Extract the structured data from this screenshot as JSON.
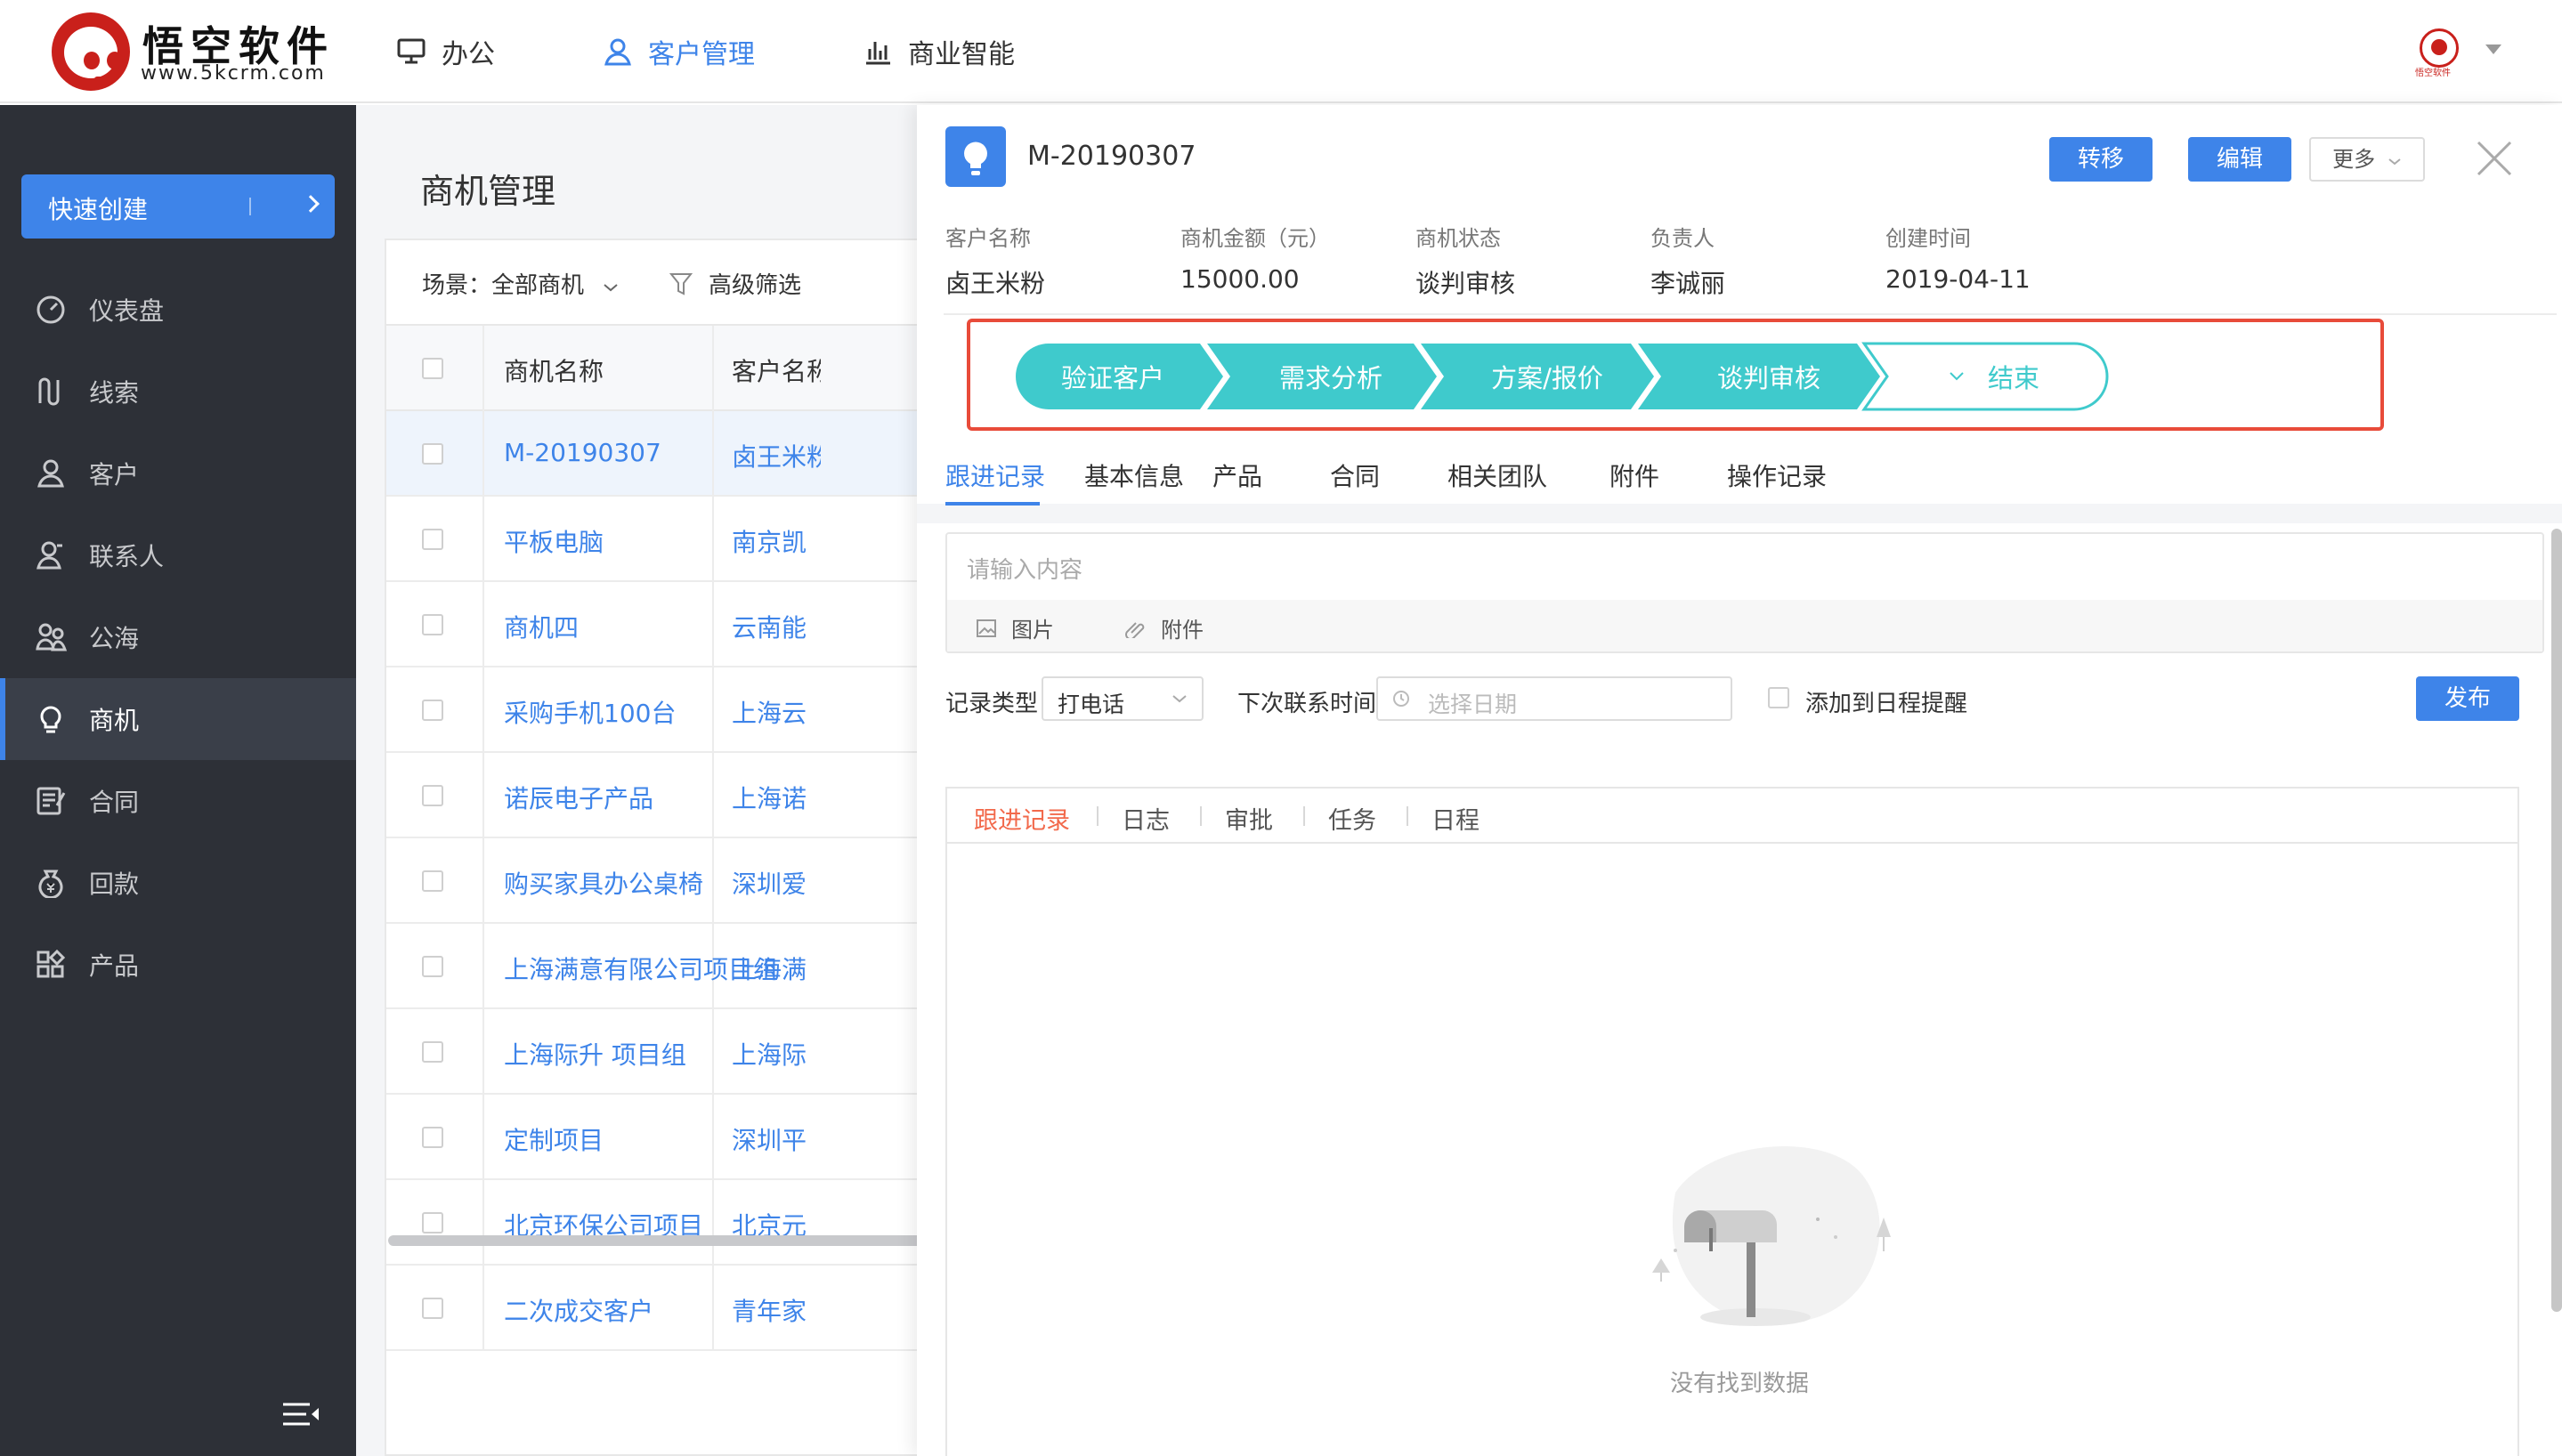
{
  "brand": {
    "name": "悟空软件",
    "url": "www.5kcrm.com",
    "avatar_caption": "悟空软件"
  },
  "topnav": [
    {
      "label": "办公",
      "icon": "monitor-icon",
      "active": false
    },
    {
      "label": "客户管理",
      "icon": "user-icon",
      "active": true
    },
    {
      "label": "商业智能",
      "icon": "bar-chart-icon",
      "active": false
    }
  ],
  "sidebar": {
    "quick_create": "快速创建",
    "items": [
      {
        "label": "仪表盘",
        "icon": "dashboard-icon"
      },
      {
        "label": "线索",
        "icon": "clue-icon"
      },
      {
        "label": "客户",
        "icon": "customer-icon"
      },
      {
        "label": "联系人",
        "icon": "contact-icon"
      },
      {
        "label": "公海",
        "icon": "pool-icon"
      },
      {
        "label": "商机",
        "icon": "bulb-icon",
        "active": true
      },
      {
        "label": "合同",
        "icon": "contract-icon"
      },
      {
        "label": "回款",
        "icon": "payment-icon"
      },
      {
        "label": "产品",
        "icon": "product-icon"
      }
    ]
  },
  "page": {
    "title": "商机管理",
    "scene_label": "场景：全部商机",
    "advanced_filter": "高级筛选",
    "columns": [
      "商机名称",
      "客户名称"
    ],
    "rows": [
      {
        "name": "M-20190307",
        "customer": "卤王米粉"
      },
      {
        "name": "平板电脑",
        "customer": "南京凯"
      },
      {
        "name": "商机四",
        "customer": "云南能"
      },
      {
        "name": "采购手机100台",
        "customer": "上海云"
      },
      {
        "name": "诺辰电子产品",
        "customer": "上海诺"
      },
      {
        "name": "购买家具办公桌椅",
        "customer": "深圳爱"
      },
      {
        "name": "上海满意有限公司项目组",
        "customer": "上海满"
      },
      {
        "name": "上海际升 项目组",
        "customer": "上海际"
      },
      {
        "name": "定制项目",
        "customer": "深圳平"
      },
      {
        "name": "北京环保公司项目",
        "customer": "北京元"
      },
      {
        "name": "二次成交客户",
        "customer": "青年家"
      }
    ]
  },
  "detail": {
    "title": "M-20190307",
    "buttons": {
      "transfer": "转移",
      "edit": "编辑",
      "more": "更多"
    },
    "info": [
      {
        "key": "客户名称",
        "value": "卤王米粉"
      },
      {
        "key": "商机金额（元）",
        "value": "15000.00"
      },
      {
        "key": "商机状态",
        "value": "谈判审核"
      },
      {
        "key": "负责人",
        "value": "李诚丽"
      },
      {
        "key": "创建时间",
        "value": "2019-04-11"
      }
    ],
    "stages": [
      "验证客户",
      "需求分析",
      "方案/报价",
      "谈判审核",
      "结束"
    ],
    "tabs": [
      "跟进记录",
      "基本信息",
      "产品",
      "合同",
      "相关团队",
      "附件",
      "操作记录"
    ],
    "editor": {
      "placeholder": "请输入内容",
      "image": "图片",
      "attachment": "附件"
    },
    "record_type_label": "记录类型",
    "record_type_value": "打电话",
    "next_contact_label": "下次联系时间",
    "date_placeholder": "选择日期",
    "reminder_label": "添加到日程提醒",
    "publish": "发布",
    "feed_tabs": [
      "跟进记录",
      "日志",
      "审批",
      "任务",
      "日程"
    ],
    "empty_text": "没有找到数据"
  },
  "colors": {
    "accent": "#3e84e9",
    "sidebar": "#2d3037",
    "stage": "#3fcacc",
    "highlight_border": "#e84b3a",
    "feed_active": "#f2694b"
  }
}
